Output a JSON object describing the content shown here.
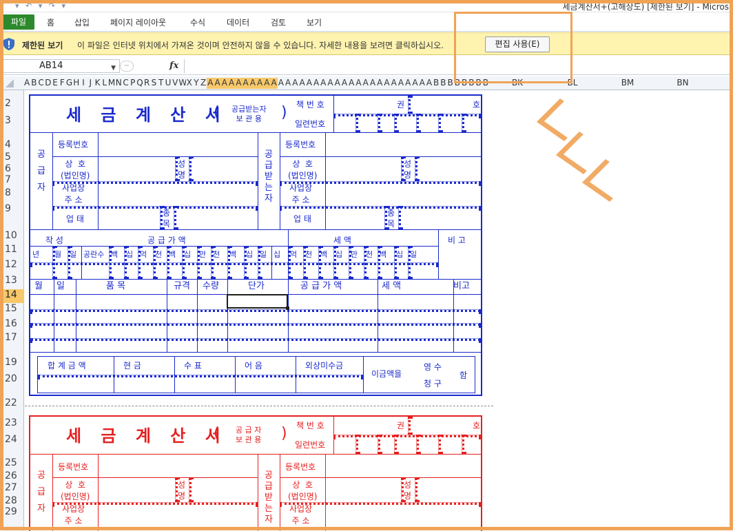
{
  "window": {
    "title": "세금계산서+(고해상도)  [제한된 보기]  -  Micros",
    "qat": "▾ ↶ ▾ ↷ ▾"
  },
  "ribbon": {
    "file_tab": "파일",
    "tabs": [
      "홈",
      "삽입",
      "페이지 레이아웃",
      "수식",
      "데이터",
      "검토",
      "보기"
    ]
  },
  "message_bar": {
    "title": "제한된 보기",
    "message": "이 파일은 인터넷 위치에서 가져온 것이며 안전하지 않을 수 있습니다. 자세한 내용을 보려면 클릭하십시오.",
    "button": "편집 사용(E)",
    "icon": "shield-icon"
  },
  "formula_bar": {
    "name_box": "AB14",
    "fx": "fx",
    "value": ""
  },
  "columns": {
    "narrow": [
      "A",
      "B",
      "C",
      "D",
      "E",
      "F",
      "G",
      "H",
      "I",
      "J",
      "K",
      "L",
      "M",
      "N",
      "C",
      "P",
      "Q",
      "R",
      "S",
      "T",
      "U",
      "V",
      "W",
      "X",
      "Y",
      "Z",
      "A",
      "A",
      "A",
      "A",
      "A",
      "A",
      "A",
      "A",
      "A",
      "A",
      "A",
      "A",
      "A",
      "A",
      "A",
      "A",
      "A",
      "A",
      "A",
      "A",
      "A",
      "A",
      "A",
      "A",
      "A",
      "A",
      "A",
      "A",
      "A",
      "A",
      "A",
      "A",
      "B",
      "B",
      "B",
      "B",
      "B",
      "B",
      "B",
      "B"
    ],
    "wide": [
      "BK",
      "BL",
      "BM",
      "BN"
    ]
  },
  "rows": [
    "2",
    "3",
    "4",
    "5",
    "6",
    "7",
    "8",
    "9",
    "10",
    "11",
    "12",
    "13",
    "14",
    "15",
    "16",
    "17",
    "19",
    "20",
    "22",
    "23",
    "24",
    "25",
    "26",
    "27",
    "28",
    "29"
  ],
  "selected_row": "14",
  "form_blue": {
    "title": "세 금 계 산 서",
    "copy_type": "공급받는자\n보 관 용",
    "paren_l": "(",
    "paren_r": ")",
    "book_no": "책 번 호",
    "serial_no": "일련번호",
    "kwon": "권",
    "ho": "호",
    "supplier": "공\n\n급\n\n자",
    "receiver": "공\n급\n받\n는\n자",
    "reg_no": "등록번호",
    "company": "상  호\n(법인명)",
    "name": "성\n명",
    "address": "사업장\n주 소",
    "biz": "업  태",
    "item_type": "종\n목",
    "written": "작   성",
    "supply_amount": "공     급     가     액",
    "tax": "세          액",
    "note": "비  고",
    "date_cols": [
      "년",
      "월",
      "일",
      "공란수",
      "백",
      "십",
      "억",
      "천",
      "백",
      "십",
      "만",
      "천",
      "백",
      "십",
      "일",
      "십",
      "억",
      "천",
      "백",
      "십",
      "만",
      "천",
      "백",
      "십",
      "일"
    ],
    "items_header": [
      "월",
      "일",
      "품       목",
      "규격",
      "수량",
      "단가",
      "공  급   가  액",
      "세      액",
      "비고"
    ],
    "totals": [
      "합 계 금 액",
      "현    금",
      "수    표",
      "어    음",
      "외상미수금"
    ],
    "receipt": "이금액을",
    "receipt_a": "영 수",
    "receipt_b": "청 구",
    "receipt_c": "함"
  },
  "form_red": {
    "title": "세 금 계 산 서",
    "copy_type": "공 급 자\n보 관 용",
    "paren_l": "(",
    "paren_r": ")",
    "book_no": "책 번 호",
    "serial_no": "일련번호",
    "kwon": "권",
    "ho": "호",
    "supplier": "공\n\n급\n\n자",
    "receiver": "공\n급\n받\n는\n자",
    "reg_no": "등록번호",
    "company": "상  호\n(법인명)",
    "name": "성\n명",
    "address": "사업장\n주 소"
  },
  "colors": {
    "accent": "#f0a355",
    "blue": "#1a2acc",
    "red": "#e52020",
    "file_tab": "#2c8a2c",
    "msgbar": "#fff3b0"
  }
}
